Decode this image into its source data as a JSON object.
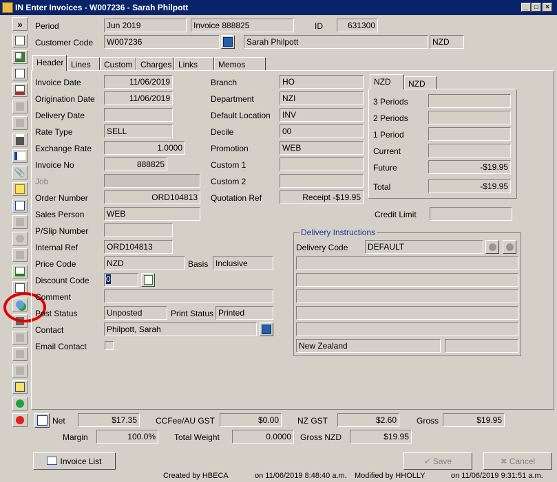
{
  "window": {
    "title": "IN Enter Invoices - W007236 - Sarah Philpott",
    "min_label": "_",
    "max_label": "□",
    "close_label": "×"
  },
  "toolbar": {
    "expand_label": "»"
  },
  "top": {
    "period_label": "Period",
    "period_value": "Jun 2019",
    "invoice_ref": "Invoice 888825",
    "id_label": "ID",
    "id_value": "631300",
    "customer_code_label": "Customer Code",
    "customer_code_value": "W007236",
    "customer_name": "Sarah Philpott",
    "currency": "NZD"
  },
  "tabs": [
    "Header",
    "Lines",
    "Custom",
    "Charges",
    "Links",
    "Memos"
  ],
  "header": {
    "invoice_date_label": "Invoice Date",
    "invoice_date": "11/06/2019",
    "origination_date_label": "Origination Date",
    "origination_date": "11/06/2019",
    "delivery_date_label": "Delivery Date",
    "delivery_date": "",
    "rate_type_label": "Rate Type",
    "rate_type": "SELL",
    "exchange_rate_label": "Exchange Rate",
    "exchange_rate": "1.0000",
    "invoice_no_label": "Invoice No",
    "invoice_no": "888825",
    "job_label": "Job",
    "job": "",
    "order_number_label": "Order Number",
    "order_number": "ORD104813",
    "sales_person_label": "Sales Person",
    "sales_person": "WEB",
    "pslip_label": "P/Slip Number",
    "pslip": "",
    "internal_ref_label": "Internal Ref",
    "internal_ref": "ORD104813",
    "price_code_label": "Price Code",
    "price_code": "NZD",
    "basis_label": "Basis",
    "basis": "Inclusive",
    "discount_code_label": "Discount Code",
    "discount_code": "0",
    "comment_label": "Comment",
    "comment": "",
    "post_status_label": "Post Status",
    "post_status": "Unposted",
    "print_status_label": "Print Status",
    "print_status": "Printed",
    "contact_label": "Contact",
    "contact": "Philpott, Sarah",
    "email_contact_label": "Email Contact",
    "branch_label": "Branch",
    "branch": "HO",
    "department_label": "Department",
    "department": "NZI",
    "default_location_label": "Default Location",
    "default_location": "INV",
    "decile_label": "Decile",
    "decile": "00",
    "promotion_label": "Promotion",
    "promotion": "WEB",
    "custom1_label": "Custom 1",
    "custom1": "",
    "custom2_label": "Custom 2",
    "custom2": "",
    "quotation_ref_label": "Quotation Ref",
    "quotation_ref": "Receipt -$19.95"
  },
  "aging": {
    "tabs": [
      "NZD",
      "NZD"
    ],
    "rows": [
      {
        "label": "3 Periods",
        "value": ""
      },
      {
        "label": "2 Periods",
        "value": ""
      },
      {
        "label": "1 Period",
        "value": ""
      },
      {
        "label": "Current",
        "value": ""
      },
      {
        "label": "Future",
        "value": "-$19.95"
      },
      {
        "label": "Total",
        "value": "-$19.95"
      }
    ],
    "credit_limit_label": "Credit Limit",
    "credit_limit": ""
  },
  "delivery": {
    "title": "Delivery Instructions",
    "code_label": "Delivery Code",
    "code": "DEFAULT",
    "lines": [
      "",
      "",
      "",
      "",
      ""
    ],
    "country": "New Zealand",
    "postcode": ""
  },
  "totals": {
    "net_label": "Net",
    "net": "$17.35",
    "ccfee_label": "CCFee/AU GST",
    "ccfee": "$0.00",
    "nzgst_label": "NZ GST",
    "nzgst": "$2.60",
    "gross_label": "Gross",
    "gross": "$19.95",
    "margin_label": "Margin",
    "margin": "100.0%",
    "weight_label": "Total Weight",
    "weight": "0.0000",
    "gross_nzd_label": "Gross NZD",
    "gross_nzd": "$19.95"
  },
  "buttons": {
    "invoice_list": "Invoice List",
    "save": "Save",
    "cancel": "Cancel"
  },
  "status": {
    "created_by": "Created by HBECA",
    "created_on": "on 11/06/2019 8:48:40 a.m.",
    "modified_by": "Modified by HHOLLY",
    "modified_on": "on 11/06/2019 9:31:51 a.m."
  },
  "colors": {
    "title_bar": "#0a246a",
    "annotation": "#e00000"
  }
}
